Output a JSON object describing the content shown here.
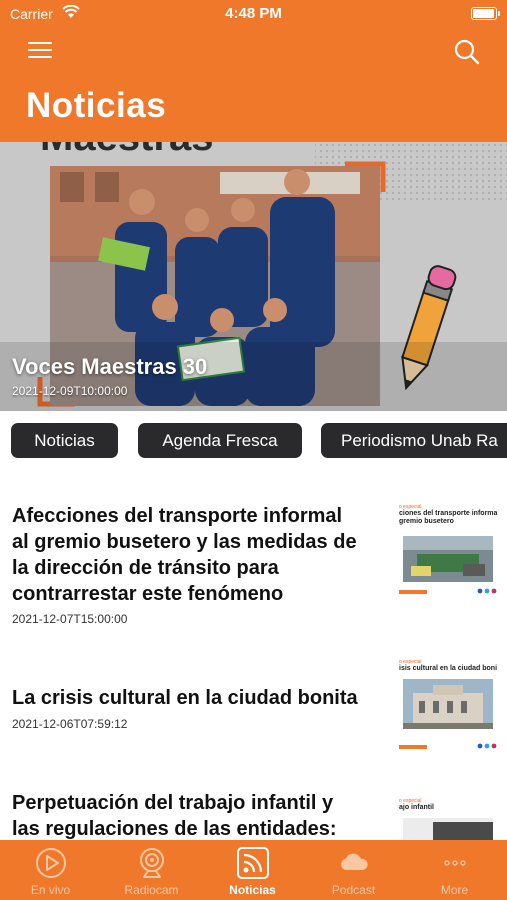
{
  "status_bar": {
    "carrier": "Carrier",
    "time": "4:48 PM",
    "battery_level": 1.0
  },
  "header": {
    "title": "Noticias",
    "menu_icon": "hamburger-menu-icon",
    "search_icon": "search-icon"
  },
  "hero": {
    "title": "Voces Maestras 30",
    "date": "2021-12-09T10:00:00",
    "background_text": "Maestras"
  },
  "categories": [
    "Noticias",
    "Agenda Fresca",
    "Periodismo Unab Ra"
  ],
  "articles": [
    {
      "title_lines": [
        "Afecciones del transporte informal",
        "al gremio busetero y las medidas de",
        "la dirección de tránsito para",
        "contrarrestar este fenómeno"
      ],
      "date": "2021-12-07T15:00:00",
      "thumb_kicker": "o especial",
      "thumb_head_lines": [
        "ciones del transporte informa",
        "gremio busetero"
      ]
    },
    {
      "title_lines": [
        "La crisis cultural en la ciudad bonita"
      ],
      "date": "2021-12-06T07:59:12",
      "thumb_kicker": "o especial",
      "thumb_head_lines": [
        "isis cultural en la ciudad boni"
      ]
    },
    {
      "title_lines": [
        "Perpetuación del trabajo infantil y",
        "las regulaciones de las entidades:"
      ],
      "date": "",
      "thumb_kicker": "o especial",
      "thumb_head_lines": [
        "ajo infantil"
      ]
    }
  ],
  "tabs": [
    {
      "label": "En vivo",
      "icon": "play-circle-icon",
      "active": false
    },
    {
      "label": "Radiocam",
      "icon": "webcam-icon",
      "active": false
    },
    {
      "label": "Noticias",
      "icon": "rss-feed-icon",
      "active": true
    },
    {
      "label": "Podcast",
      "icon": "cloud-icon",
      "active": false
    },
    {
      "label": "More",
      "icon": "more-dots-icon",
      "active": false
    }
  ],
  "colors": {
    "brand": "#f0782a",
    "pill": "#2a2a2c",
    "tab_inactive": "#fbc7a3"
  }
}
